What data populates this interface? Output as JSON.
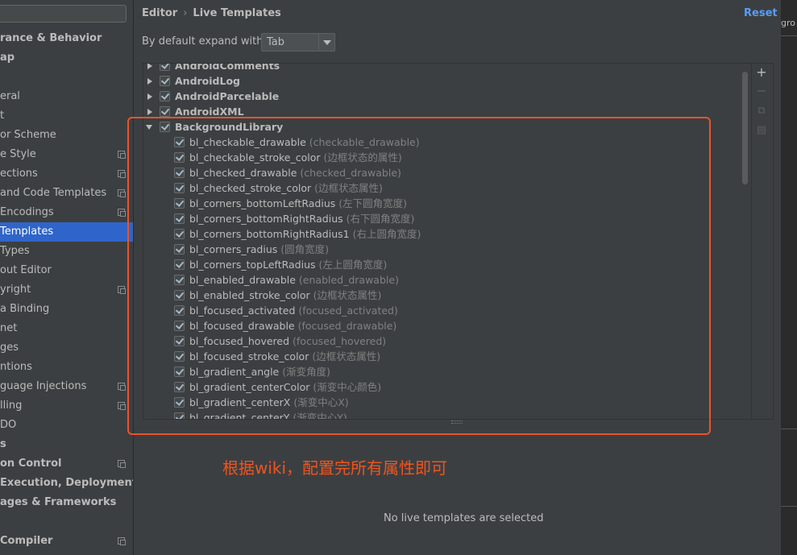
{
  "sidebar": {
    "search_placeholder": "",
    "items": [
      {
        "label": "rance & Behavior",
        "bold": true,
        "icon": false,
        "selected": false
      },
      {
        "label": "ap",
        "bold": true,
        "icon": false,
        "selected": false
      },
      {
        "label": "",
        "bold": false,
        "icon": false,
        "selected": false
      },
      {
        "label": "eral",
        "bold": false,
        "icon": false,
        "selected": false
      },
      {
        "label": "t",
        "bold": false,
        "icon": false,
        "selected": false
      },
      {
        "label": "or Scheme",
        "bold": false,
        "icon": false,
        "selected": false
      },
      {
        "label": "e Style",
        "bold": false,
        "icon": true,
        "selected": false
      },
      {
        "label": "ections",
        "bold": false,
        "icon": true,
        "selected": false
      },
      {
        "label": "and Code Templates",
        "bold": false,
        "icon": true,
        "selected": false
      },
      {
        "label": "Encodings",
        "bold": false,
        "icon": true,
        "selected": false
      },
      {
        "label": " Templates",
        "bold": false,
        "icon": false,
        "selected": true
      },
      {
        "label": "Types",
        "bold": false,
        "icon": false,
        "selected": false
      },
      {
        "label": "out Editor",
        "bold": false,
        "icon": false,
        "selected": false
      },
      {
        "label": "yright",
        "bold": false,
        "icon": true,
        "selected": false
      },
      {
        "label": "a Binding",
        "bold": false,
        "icon": false,
        "selected": false
      },
      {
        "label": "net",
        "bold": false,
        "icon": false,
        "selected": false
      },
      {
        "label": "ges",
        "bold": false,
        "icon": false,
        "selected": false
      },
      {
        "label": "ntions",
        "bold": false,
        "icon": false,
        "selected": false
      },
      {
        "label": "guage Injections",
        "bold": false,
        "icon": true,
        "selected": false
      },
      {
        "label": "lling",
        "bold": false,
        "icon": true,
        "selected": false
      },
      {
        "label": "DO",
        "bold": false,
        "icon": false,
        "selected": false
      },
      {
        "label": "s",
        "bold": true,
        "icon": false,
        "selected": false
      },
      {
        "label": "on Control",
        "bold": true,
        "icon": true,
        "selected": false
      },
      {
        "label": " Execution, Deployment",
        "bold": true,
        "icon": false,
        "selected": false
      },
      {
        "label": "ages & Frameworks",
        "bold": true,
        "icon": false,
        "selected": false
      },
      {
        "label": "",
        "bold": false,
        "icon": false,
        "selected": false
      },
      {
        "label": " Compiler",
        "bold": true,
        "icon": true,
        "selected": false
      }
    ]
  },
  "header": {
    "breadcrumb_parent": "Editor",
    "breadcrumb_separator": "›",
    "breadcrumb_current": "Live Templates",
    "reset_label": "Reset"
  },
  "expand": {
    "label": "By default expand with",
    "value": "Tab"
  },
  "tree": {
    "groups_collapsed": [
      "AndroidComments",
      "AndroidLog",
      "AndroidParcelable",
      "AndroidXML"
    ],
    "expanded_group": "BackgroundLibrary",
    "templates": [
      {
        "name": "bl_checkable_drawable",
        "desc": "(checkable_drawable)"
      },
      {
        "name": "bl_checkable_stroke_color",
        "desc": "(边框状态的属性)"
      },
      {
        "name": "bl_checked_drawable",
        "desc": "(checked_drawable)"
      },
      {
        "name": "bl_checked_stroke_color",
        "desc": "(边框状态属性)"
      },
      {
        "name": "bl_corners_bottomLeftRadius",
        "desc": "(左下圆角宽度)"
      },
      {
        "name": "bl_corners_bottomRightRadius",
        "desc": "(右下圆角宽度)"
      },
      {
        "name": "bl_corners_bottomRightRadius1",
        "desc": "(右上圆角宽度)"
      },
      {
        "name": "bl_corners_radius",
        "desc": "(圆角宽度)"
      },
      {
        "name": "bl_corners_topLeftRadius",
        "desc": "(左上圆角宽度)"
      },
      {
        "name": "bl_enabled_drawable",
        "desc": "(enabled_drawable)"
      },
      {
        "name": "bl_enabled_stroke_color",
        "desc": "(边框状态属性)"
      },
      {
        "name": "bl_focused_activated",
        "desc": "(focused_activated)"
      },
      {
        "name": "bl_focused_drawable",
        "desc": "(focused_drawable)"
      },
      {
        "name": "bl_focused_hovered",
        "desc": "(focused_hovered)"
      },
      {
        "name": "bl_focused_stroke_color",
        "desc": "(边框状态属性)"
      },
      {
        "name": "bl_gradient_angle",
        "desc": "(渐变角度)"
      },
      {
        "name": "bl_gradient_centerColor",
        "desc": "(渐变中心颜色)"
      },
      {
        "name": "bl_gradient_centerX",
        "desc": "(渐变中心X)"
      },
      {
        "name": "bl_gradient_centerY",
        "desc": "(渐变中心Y)"
      }
    ]
  },
  "toolbar": {
    "add_icon": "plus-icon",
    "remove_icon": "minus-icon",
    "copy_icon": "copy-icon",
    "changelist_icon": "changelist-icon"
  },
  "annotation": {
    "text": "根据wiki，配置完所有属性即可",
    "color": "#f0541e"
  },
  "empty_message": "No live templates are selected",
  "right_strip": {
    "tab_label": "gro"
  },
  "colors": {
    "background": "#3c3f41",
    "selection": "#2f65ca",
    "link": "#589df6",
    "annotation_border": "#e8542c"
  }
}
